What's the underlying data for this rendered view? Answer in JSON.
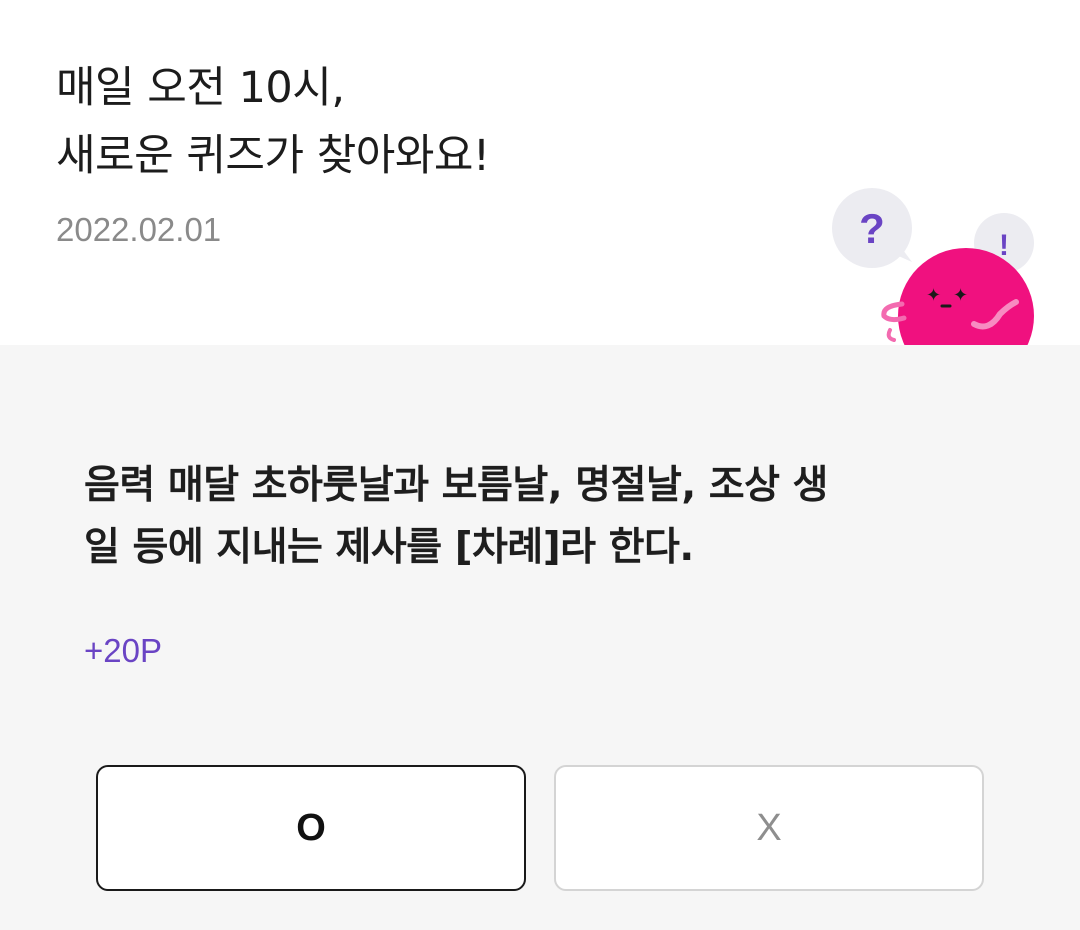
{
  "header": {
    "headline_line1": "매일 오전 10시,",
    "headline_line2": "새로운 퀴즈가 찾아와요!",
    "date": "2022.02.01"
  },
  "mascot": {
    "icons": [
      "question-bubble-icon",
      "exclamation-bubble-icon",
      "pink-character-icon"
    ],
    "bubble_left_text": "?",
    "bubble_right_text": "!",
    "colors": {
      "character": "#f0117f",
      "bubble": "#ececf1",
      "question_mark": "#6a44c4"
    }
  },
  "quiz": {
    "question_line1": "음력 매달 초하룻날과 보름날, 명절날, 조상 생",
    "question_line2": "일 등에 지내는 제사를 [차례]라 한다.",
    "reward": "+20P",
    "options": {
      "o_label": "O",
      "x_label": "X"
    }
  },
  "colors": {
    "accent": "#6a44c4",
    "quiz_background": "#f6f6f6",
    "date_text": "#8a8a8a"
  }
}
